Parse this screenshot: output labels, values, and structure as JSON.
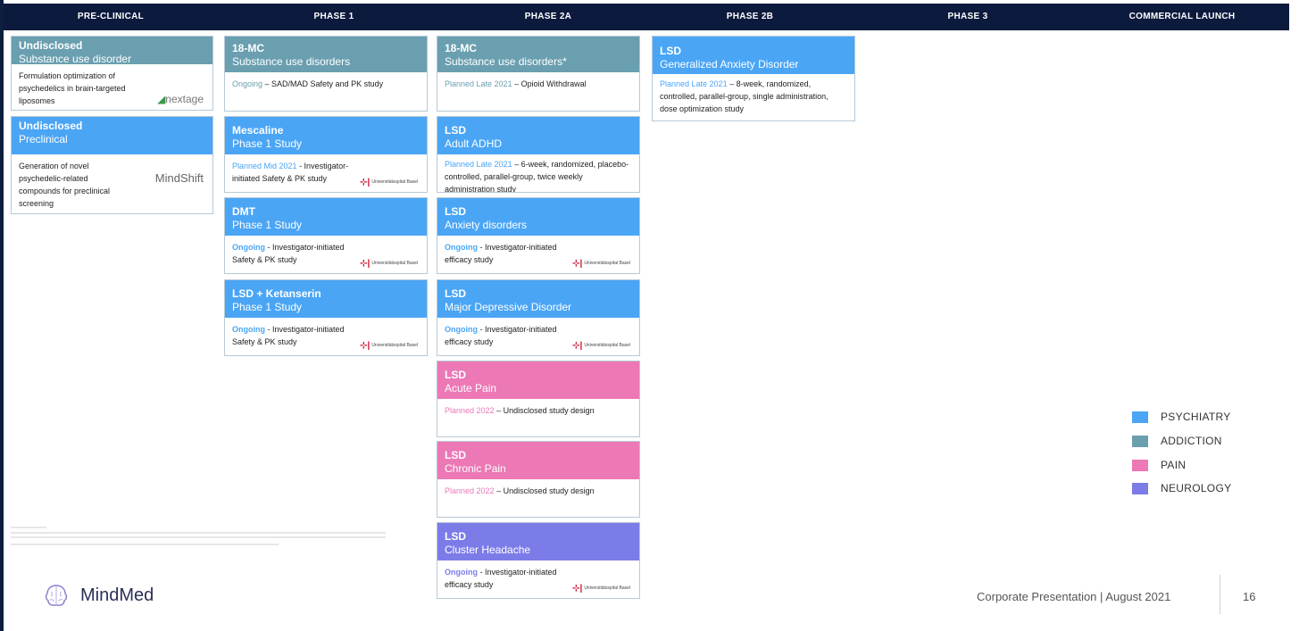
{
  "phases": [
    "PRE-CLINICAL",
    "PHASE 1",
    "PHASE 2A",
    "PHASE 2B",
    "PHASE 3",
    "COMMERCIAL LAUNCH"
  ],
  "cards": {
    "pc1": {
      "name": "Undisclosed",
      "indication": "Substance use disorder",
      "text": "Formulation optimization of psychedelics in brain-targeted liposomes",
      "partner": "nextage"
    },
    "pc2": {
      "name": "Undisclosed",
      "indication": "Preclinical",
      "text": "Generation of novel psychedelic-related compounds for preclinical screening",
      "partner": "MindShift"
    },
    "p1a": {
      "name": "18-MC",
      "indication": "Substance use disorders",
      "status": "Ongoing",
      "text": " – SAD/MAD Safety and PK study"
    },
    "p1b": {
      "name": "Mescaline",
      "indication": "Phase 1 Study",
      "status": "Planned Mid 2021",
      "text": " - Investigator-initiated Safety & PK study"
    },
    "p1c": {
      "name": "DMT",
      "indication": "Phase 1 Study",
      "status": "Ongoing",
      "text": " - Investigator-initiated Safety & PK study"
    },
    "p1d": {
      "name": "LSD + Ketanserin",
      "indication": "Phase 1 Study",
      "status": "Ongoing",
      "text": " - Investigator-initiated Safety & PK study"
    },
    "p2a1": {
      "name": "18-MC",
      "indication": "Substance use disorders*",
      "status": "Planned Late 2021",
      "text": " – Opioid Withdrawal"
    },
    "p2a2": {
      "name": "LSD",
      "indication": "Adult ADHD",
      "status": "Planned Late 2021",
      "text": " – 6-week, randomized, placebo-controlled, parallel-group, twice weekly administration study"
    },
    "p2a3": {
      "name": "LSD",
      "indication": "Anxiety disorders",
      "status": "Ongoing",
      "text": " - Investigator-initiated efficacy study"
    },
    "p2a4": {
      "name": "LSD",
      "indication": "Major Depressive Disorder",
      "status": "Ongoing",
      "text": " - Investigator-initiated efficacy study"
    },
    "p2a5": {
      "name": "LSD",
      "indication": "Acute Pain",
      "status": "Planned 2022",
      "text": " – Undisclosed study design"
    },
    "p2a6": {
      "name": "LSD",
      "indication": "Chronic Pain",
      "status": "Planned 2022",
      "text": " – Undisclosed study design"
    },
    "p2a7": {
      "name": "LSD",
      "indication": "Cluster Headache",
      "status": "Ongoing",
      "text": " - Investigator-initiated efficacy study"
    },
    "p2b1": {
      "name": "LSD",
      "indication": "Generalized Anxiety Disorder",
      "status": "Planned Late 2021",
      "text": " – 8-week, randomized, controlled, parallel-group, single administration, dose optimization study"
    }
  },
  "basel_logo": "Universitätsspital Basel",
  "legend": [
    {
      "label": "PSYCHIATRY",
      "color": "#4aa5f5"
    },
    {
      "label": "ADDICTION",
      "color": "#6a9fb0"
    },
    {
      "label": "PAIN",
      "color": "#ec78b6"
    },
    {
      "label": "NEUROLOGY",
      "color": "#7c7ce8"
    }
  ],
  "footer": {
    "brand": "MindMed",
    "presentation": "Corporate Presentation | August 2021",
    "page": "16"
  }
}
